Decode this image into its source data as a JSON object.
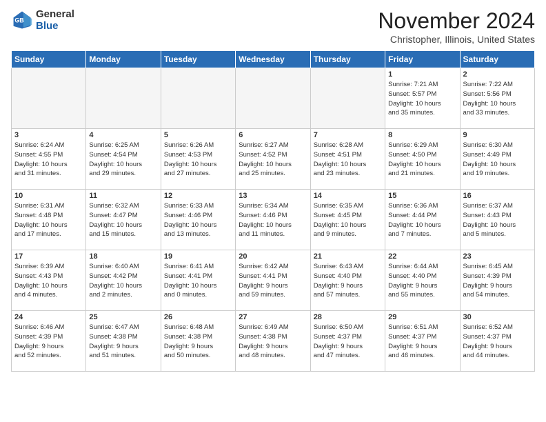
{
  "header": {
    "logo_general": "General",
    "logo_blue": "Blue",
    "month_title": "November 2024",
    "location": "Christopher, Illinois, United States"
  },
  "weekdays": [
    "Sunday",
    "Monday",
    "Tuesday",
    "Wednesday",
    "Thursday",
    "Friday",
    "Saturday"
  ],
  "weeks": [
    [
      {
        "day": "",
        "info": ""
      },
      {
        "day": "",
        "info": ""
      },
      {
        "day": "",
        "info": ""
      },
      {
        "day": "",
        "info": ""
      },
      {
        "day": "",
        "info": ""
      },
      {
        "day": "1",
        "info": "Sunrise: 7:21 AM\nSunset: 5:57 PM\nDaylight: 10 hours\nand 35 minutes."
      },
      {
        "day": "2",
        "info": "Sunrise: 7:22 AM\nSunset: 5:56 PM\nDaylight: 10 hours\nand 33 minutes."
      }
    ],
    [
      {
        "day": "3",
        "info": "Sunrise: 6:24 AM\nSunset: 4:55 PM\nDaylight: 10 hours\nand 31 minutes."
      },
      {
        "day": "4",
        "info": "Sunrise: 6:25 AM\nSunset: 4:54 PM\nDaylight: 10 hours\nand 29 minutes."
      },
      {
        "day": "5",
        "info": "Sunrise: 6:26 AM\nSunset: 4:53 PM\nDaylight: 10 hours\nand 27 minutes."
      },
      {
        "day": "6",
        "info": "Sunrise: 6:27 AM\nSunset: 4:52 PM\nDaylight: 10 hours\nand 25 minutes."
      },
      {
        "day": "7",
        "info": "Sunrise: 6:28 AM\nSunset: 4:51 PM\nDaylight: 10 hours\nand 23 minutes."
      },
      {
        "day": "8",
        "info": "Sunrise: 6:29 AM\nSunset: 4:50 PM\nDaylight: 10 hours\nand 21 minutes."
      },
      {
        "day": "9",
        "info": "Sunrise: 6:30 AM\nSunset: 4:49 PM\nDaylight: 10 hours\nand 19 minutes."
      }
    ],
    [
      {
        "day": "10",
        "info": "Sunrise: 6:31 AM\nSunset: 4:48 PM\nDaylight: 10 hours\nand 17 minutes."
      },
      {
        "day": "11",
        "info": "Sunrise: 6:32 AM\nSunset: 4:47 PM\nDaylight: 10 hours\nand 15 minutes."
      },
      {
        "day": "12",
        "info": "Sunrise: 6:33 AM\nSunset: 4:46 PM\nDaylight: 10 hours\nand 13 minutes."
      },
      {
        "day": "13",
        "info": "Sunrise: 6:34 AM\nSunset: 4:46 PM\nDaylight: 10 hours\nand 11 minutes."
      },
      {
        "day": "14",
        "info": "Sunrise: 6:35 AM\nSunset: 4:45 PM\nDaylight: 10 hours\nand 9 minutes."
      },
      {
        "day": "15",
        "info": "Sunrise: 6:36 AM\nSunset: 4:44 PM\nDaylight: 10 hours\nand 7 minutes."
      },
      {
        "day": "16",
        "info": "Sunrise: 6:37 AM\nSunset: 4:43 PM\nDaylight: 10 hours\nand 5 minutes."
      }
    ],
    [
      {
        "day": "17",
        "info": "Sunrise: 6:39 AM\nSunset: 4:43 PM\nDaylight: 10 hours\nand 4 minutes."
      },
      {
        "day": "18",
        "info": "Sunrise: 6:40 AM\nSunset: 4:42 PM\nDaylight: 10 hours\nand 2 minutes."
      },
      {
        "day": "19",
        "info": "Sunrise: 6:41 AM\nSunset: 4:41 PM\nDaylight: 10 hours\nand 0 minutes."
      },
      {
        "day": "20",
        "info": "Sunrise: 6:42 AM\nSunset: 4:41 PM\nDaylight: 9 hours\nand 59 minutes."
      },
      {
        "day": "21",
        "info": "Sunrise: 6:43 AM\nSunset: 4:40 PM\nDaylight: 9 hours\nand 57 minutes."
      },
      {
        "day": "22",
        "info": "Sunrise: 6:44 AM\nSunset: 4:40 PM\nDaylight: 9 hours\nand 55 minutes."
      },
      {
        "day": "23",
        "info": "Sunrise: 6:45 AM\nSunset: 4:39 PM\nDaylight: 9 hours\nand 54 minutes."
      }
    ],
    [
      {
        "day": "24",
        "info": "Sunrise: 6:46 AM\nSunset: 4:39 PM\nDaylight: 9 hours\nand 52 minutes."
      },
      {
        "day": "25",
        "info": "Sunrise: 6:47 AM\nSunset: 4:38 PM\nDaylight: 9 hours\nand 51 minutes."
      },
      {
        "day": "26",
        "info": "Sunrise: 6:48 AM\nSunset: 4:38 PM\nDaylight: 9 hours\nand 50 minutes."
      },
      {
        "day": "27",
        "info": "Sunrise: 6:49 AM\nSunset: 4:38 PM\nDaylight: 9 hours\nand 48 minutes."
      },
      {
        "day": "28",
        "info": "Sunrise: 6:50 AM\nSunset: 4:37 PM\nDaylight: 9 hours\nand 47 minutes."
      },
      {
        "day": "29",
        "info": "Sunrise: 6:51 AM\nSunset: 4:37 PM\nDaylight: 9 hours\nand 46 minutes."
      },
      {
        "day": "30",
        "info": "Sunrise: 6:52 AM\nSunset: 4:37 PM\nDaylight: 9 hours\nand 44 minutes."
      }
    ]
  ]
}
